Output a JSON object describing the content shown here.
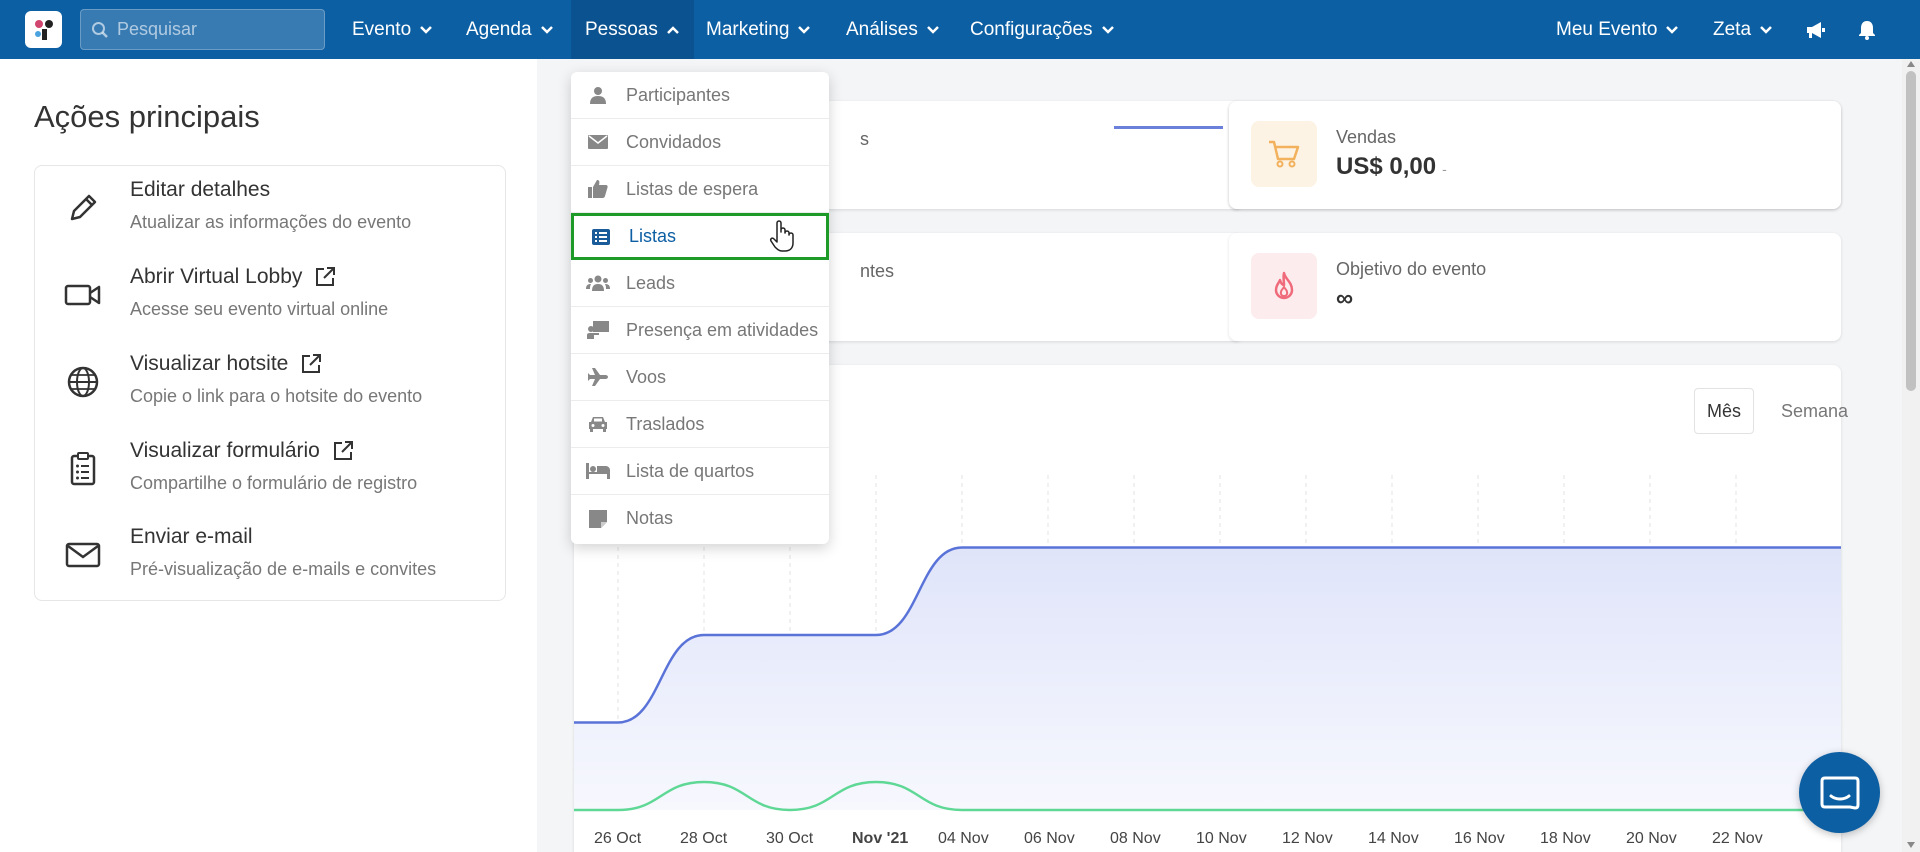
{
  "nav": {
    "search_placeholder": "Pesquisar",
    "items": [
      {
        "label": "Evento"
      },
      {
        "label": "Agenda"
      },
      {
        "label": "Pessoas"
      },
      {
        "label": "Marketing"
      },
      {
        "label": "Análises"
      },
      {
        "label": "Configurações"
      }
    ],
    "right_items": [
      {
        "label": "Meu Evento"
      },
      {
        "label": "Zeta"
      }
    ]
  },
  "left_panel": {
    "title": "Ações principais",
    "actions": [
      {
        "title": "Editar detalhes",
        "subtitle": "Atualizar as informações do evento",
        "icon": "pencil-icon"
      },
      {
        "title": "Abrir Virtual Lobby",
        "subtitle": "Acesse seu evento virtual online",
        "icon": "video-camera-icon"
      },
      {
        "title": "Visualizar hotsite",
        "subtitle": "Copie o link para o hotsite do evento",
        "icon": "globe-icon"
      },
      {
        "title": "Visualizar formulário",
        "subtitle": "Compartilhe o formulário de registro",
        "icon": "clipboard-icon"
      },
      {
        "title": "Enviar e-mail",
        "subtitle": "Pré-visualização de e-mails e convites",
        "icon": "envelope-icon"
      }
    ]
  },
  "stats": {
    "card1_label_fragment": "s",
    "card3_label_fragment": "ntes",
    "sales": {
      "label": "Vendas",
      "value": "US$ 0,00",
      "delta": "-"
    },
    "goal": {
      "label": "Objetivo do evento",
      "value": "∞"
    }
  },
  "chart_toggle": {
    "month": "Mês",
    "week": "Semana"
  },
  "dropdown": {
    "items": [
      {
        "label": "Participantes",
        "icon": "user-icon"
      },
      {
        "label": "Convidados",
        "icon": "envelope-icon"
      },
      {
        "label": "Listas de espera",
        "icon": "thumbs-up-icon"
      },
      {
        "label": "Listas",
        "icon": "list-icon"
      },
      {
        "label": "Leads",
        "icon": "users-icon"
      },
      {
        "label": "Presença em atividades",
        "icon": "presentation-icon"
      },
      {
        "label": "Voos",
        "icon": "plane-icon"
      },
      {
        "label": "Traslados",
        "icon": "car-icon"
      },
      {
        "label": "Lista de quartos",
        "icon": "bed-icon"
      },
      {
        "label": "Notas",
        "icon": "note-icon"
      }
    ]
  },
  "chart_data": {
    "type": "area",
    "x": [
      "26 Oct",
      "28 Oct",
      "30 Oct",
      "Nov '21",
      "04 Nov",
      "06 Nov",
      "08 Nov",
      "10 Nov",
      "12 Nov",
      "14 Nov",
      "16 Nov",
      "18 Nov",
      "20 Nov",
      "22 Nov"
    ],
    "series": [
      {
        "values": [
          1,
          2,
          2,
          2,
          3,
          3,
          3,
          3,
          3,
          3,
          3,
          3,
          3,
          3
        ],
        "color": "#5a73d8"
      },
      {
        "values": [
          0,
          1,
          0,
          1,
          0,
          0,
          0,
          0,
          0,
          0,
          0,
          0,
          0,
          0
        ],
        "color": "#5fd896"
      }
    ],
    "grid": true
  }
}
